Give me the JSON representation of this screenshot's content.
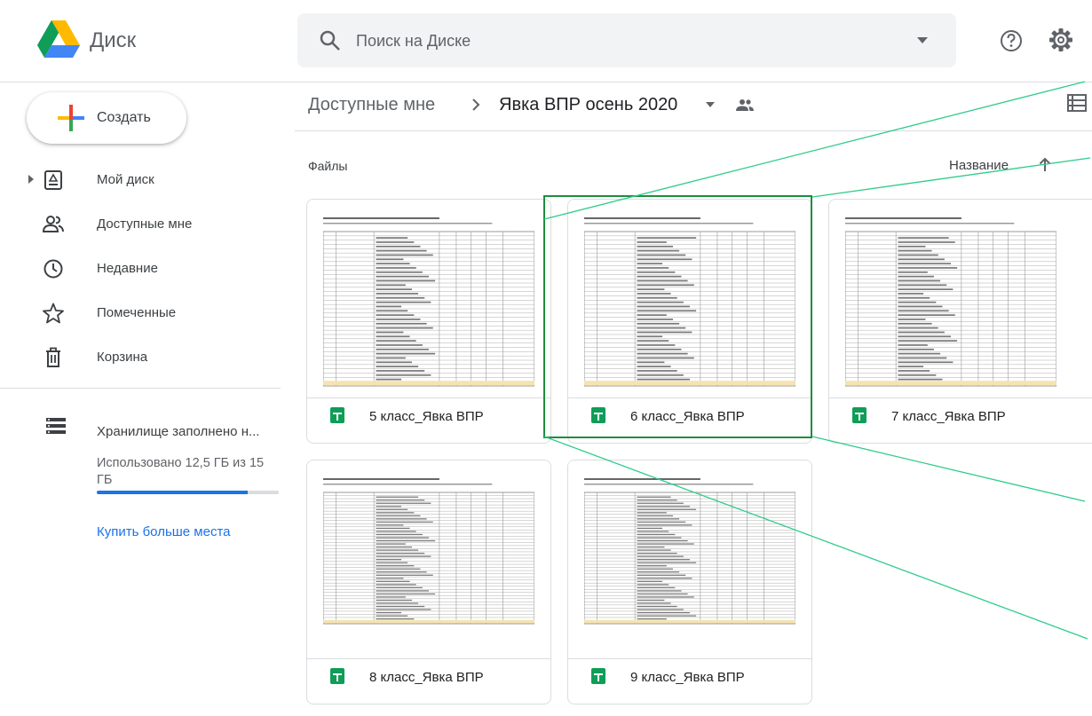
{
  "header": {
    "app_name": "Диск",
    "search_placeholder": "Поиск на Диске"
  },
  "sidebar": {
    "create_label": "Создать",
    "items": [
      {
        "label": "Мой диск",
        "icon": "my-drive-icon"
      },
      {
        "label": "Доступные мне",
        "icon": "shared-icon"
      },
      {
        "label": "Недавние",
        "icon": "recent-icon"
      },
      {
        "label": "Помеченные",
        "icon": "star-icon"
      },
      {
        "label": "Корзина",
        "icon": "trash-icon"
      }
    ],
    "storage": {
      "title": "Хранилище заполнено н...",
      "used_text": "Использовано 12,5 ГБ из 15 ГБ",
      "used_fraction": 0.83,
      "buy_label": "Купить больше места"
    }
  },
  "breadcrumb": {
    "shared": "Доступные мне",
    "folder": "Явка ВПР осень 2020"
  },
  "files_section": {
    "label": "Файлы",
    "sort_label": "Название"
  },
  "files": [
    {
      "name": "5 класс_Явка ВПР",
      "type": "google-sheets"
    },
    {
      "name": "6 класс_Явка ВПР",
      "type": "google-sheets"
    },
    {
      "name": "7 класс_Явка ВПР",
      "type": "google-sheets"
    },
    {
      "name": "8 класс_Явка ВПР",
      "type": "google-sheets"
    },
    {
      "name": "9 класс_Явка ВПР",
      "type": "google-sheets"
    }
  ],
  "colors": {
    "accent": "#1a73e8",
    "sheets_green": "#0f9d58",
    "highlight_green": "#1e8e3e"
  }
}
